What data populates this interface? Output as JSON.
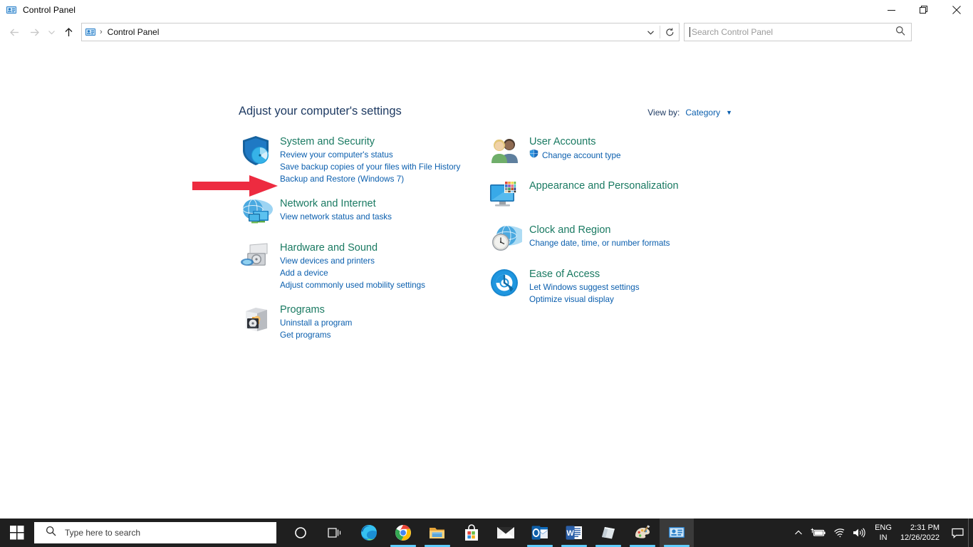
{
  "window": {
    "title": "Control Panel",
    "icon": "control-panel-icon",
    "controls": {
      "minimize": "minimize-icon",
      "restore": "restore-icon",
      "close": "close-icon"
    }
  },
  "navbar": {
    "back": "back-arrow-icon",
    "forward": "forward-arrow-icon",
    "recent": "chevron-down-icon",
    "up": "up-arrow-icon",
    "breadcrumb": {
      "icon": "control-panel-icon",
      "separator": "›",
      "text": "Control Panel"
    },
    "address_dropdown": "chevron-down-icon",
    "refresh": "refresh-icon"
  },
  "search": {
    "placeholder": "Search Control Panel",
    "value": "",
    "icon": "search-icon"
  },
  "main": {
    "heading": "Adjust your computer's settings",
    "view_by": {
      "label": "View by:",
      "value": "Category",
      "caret": "▼"
    },
    "left_column": [
      {
        "icon": "shield-icon",
        "title": "System and Security",
        "links": [
          {
            "text": "Review your computer's status",
            "shield": false
          },
          {
            "text": "Save backup copies of your files with File History",
            "shield": false
          },
          {
            "text": "Backup and Restore (Windows 7)",
            "shield": false
          }
        ]
      },
      {
        "icon": "network-globe-icon",
        "title": "Network and Internet",
        "links": [
          {
            "text": "View network status and tasks",
            "shield": false
          }
        ]
      },
      {
        "icon": "printer-icon",
        "title": "Hardware and Sound",
        "links": [
          {
            "text": "View devices and printers",
            "shield": false
          },
          {
            "text": "Add a device",
            "shield": false
          },
          {
            "text": "Adjust commonly used mobility settings",
            "shield": false
          }
        ]
      },
      {
        "icon": "programs-box-icon",
        "title": "Programs",
        "links": [
          {
            "text": "Uninstall a program",
            "shield": false
          },
          {
            "text": "Get programs",
            "shield": false
          }
        ]
      }
    ],
    "right_column": [
      {
        "icon": "user-accounts-icon",
        "title": "User Accounts",
        "links": [
          {
            "text": "Change account type",
            "shield": true
          }
        ]
      },
      {
        "icon": "appearance-monitor-icon",
        "title": "Appearance and Personalization",
        "links": []
      },
      {
        "icon": "clock-region-icon",
        "title": "Clock and Region",
        "links": [
          {
            "text": "Change date, time, or number formats",
            "shield": false
          }
        ]
      },
      {
        "icon": "ease-of-access-icon",
        "title": "Ease of Access",
        "links": [
          {
            "text": "Let Windows suggest settings",
            "shield": false
          },
          {
            "text": "Optimize visual display",
            "shield": false
          }
        ]
      }
    ]
  },
  "annotation": {
    "arrow": "red-arrow-pointer",
    "color": "#ED2B40",
    "points_at": "Backup and Restore (Windows 7)"
  },
  "taskbar": {
    "start": "windows-start-icon",
    "search": {
      "placeholder": "Type here to search",
      "icon": "search-icon"
    },
    "apps": [
      {
        "name": "cortana-icon",
        "active": false,
        "running": false
      },
      {
        "name": "task-view-icon",
        "active": false,
        "running": false
      },
      {
        "name": "microsoft-edge-icon",
        "active": false,
        "running": false
      },
      {
        "name": "google-chrome-icon",
        "active": false,
        "running": true
      },
      {
        "name": "file-explorer-icon",
        "active": false,
        "running": true
      },
      {
        "name": "microsoft-store-icon",
        "active": false,
        "running": false
      },
      {
        "name": "mail-icon",
        "active": false,
        "running": false
      },
      {
        "name": "outlook-icon",
        "active": false,
        "running": true
      },
      {
        "name": "word-icon",
        "active": false,
        "running": true
      },
      {
        "name": "sticky-notes-icon",
        "active": false,
        "running": true
      },
      {
        "name": "paint-icon",
        "active": false,
        "running": true
      },
      {
        "name": "control-panel-icon",
        "active": true,
        "running": true
      }
    ],
    "tray": {
      "overflow": "chevron-up-icon",
      "battery": "battery-charging-icon",
      "network": "wifi-icon",
      "volume": "speaker-icon",
      "language_top": "ENG",
      "language_bottom": "IN",
      "time": "2:31 PM",
      "date": "12/26/2022",
      "action_center": "notification-icon"
    }
  },
  "colors": {
    "accent_link": "#0b5fae",
    "category_title": "#1a7a62",
    "heading": "#1f3b63",
    "taskbar_bg": "#1f1f1f",
    "arrow_red": "#ED2B40"
  }
}
